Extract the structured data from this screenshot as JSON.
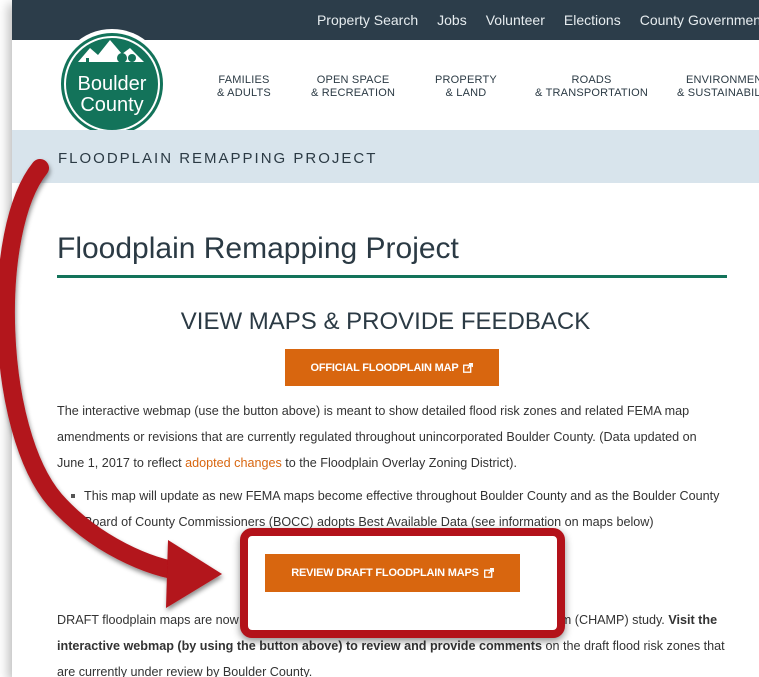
{
  "topnav": {
    "links": [
      "Property Search",
      "Jobs",
      "Volunteer",
      "Elections",
      "County Government"
    ]
  },
  "logo": {
    "line1": "Boulder",
    "line2": "County"
  },
  "mainnav": {
    "items": [
      {
        "line1": "FAMILIES",
        "line2": "& ADULTS"
      },
      {
        "line1": "OPEN SPACE",
        "line2": "& RECREATION"
      },
      {
        "line1": "PROPERTY",
        "line2": "& LAND"
      },
      {
        "line1": "ROADS",
        "line2": "& TRANSPORTATION"
      },
      {
        "line1": "ENVIRONMENT",
        "line2": "& SUSTAINABILITY"
      }
    ]
  },
  "banner": {
    "title": "FLOODPLAIN REMAPPING PROJECT"
  },
  "content": {
    "page_title": "Floodplain Remapping Project",
    "section_heading": "VIEW MAPS & PROVIDE FEEDBACK",
    "official_button_label": "OFFICIAL FLOODPLAIN MAP",
    "p1_before_link": "The interactive webmap (use the button above) is meant to show detailed flood risk zones and related FEMA map amendments or revisions that are currently regulated throughout unincorporated Boulder County. (Data updated on June 1, 2017 to reflect ",
    "p1_link": "adopted changes",
    "p1_after_link": " to the Floodplain Overlay Zoning District).",
    "bullet": "This map will update as new FEMA maps become effective throughout Boulder County and as the Boulder County Board of County Commissioners (BOCC) adopts Best Available Data (see information on maps below)",
    "draft_button_label": "REVIEW DRAFT FLOODPLAIN MAPS",
    "p2_start": "DRAFT floodplain maps are now available as part of the Colorado Hazard Mapping Program (CHAMP) study. ",
    "p2_bold": "Visit the interactive webmap (by using the button above) to review and provide comments",
    "p2_end": " on the draft flood risk zones that are currently under review by Boulder County."
  },
  "colors": {
    "topbar": "#2c3d4a",
    "brand_green": "#13735a",
    "orange": "#d8660f",
    "band": "#d8e4ec",
    "annotation_red": "#b3121a"
  },
  "icons": {
    "external_link": "external-link-icon",
    "arrow": "curved-arrow-annotation"
  }
}
